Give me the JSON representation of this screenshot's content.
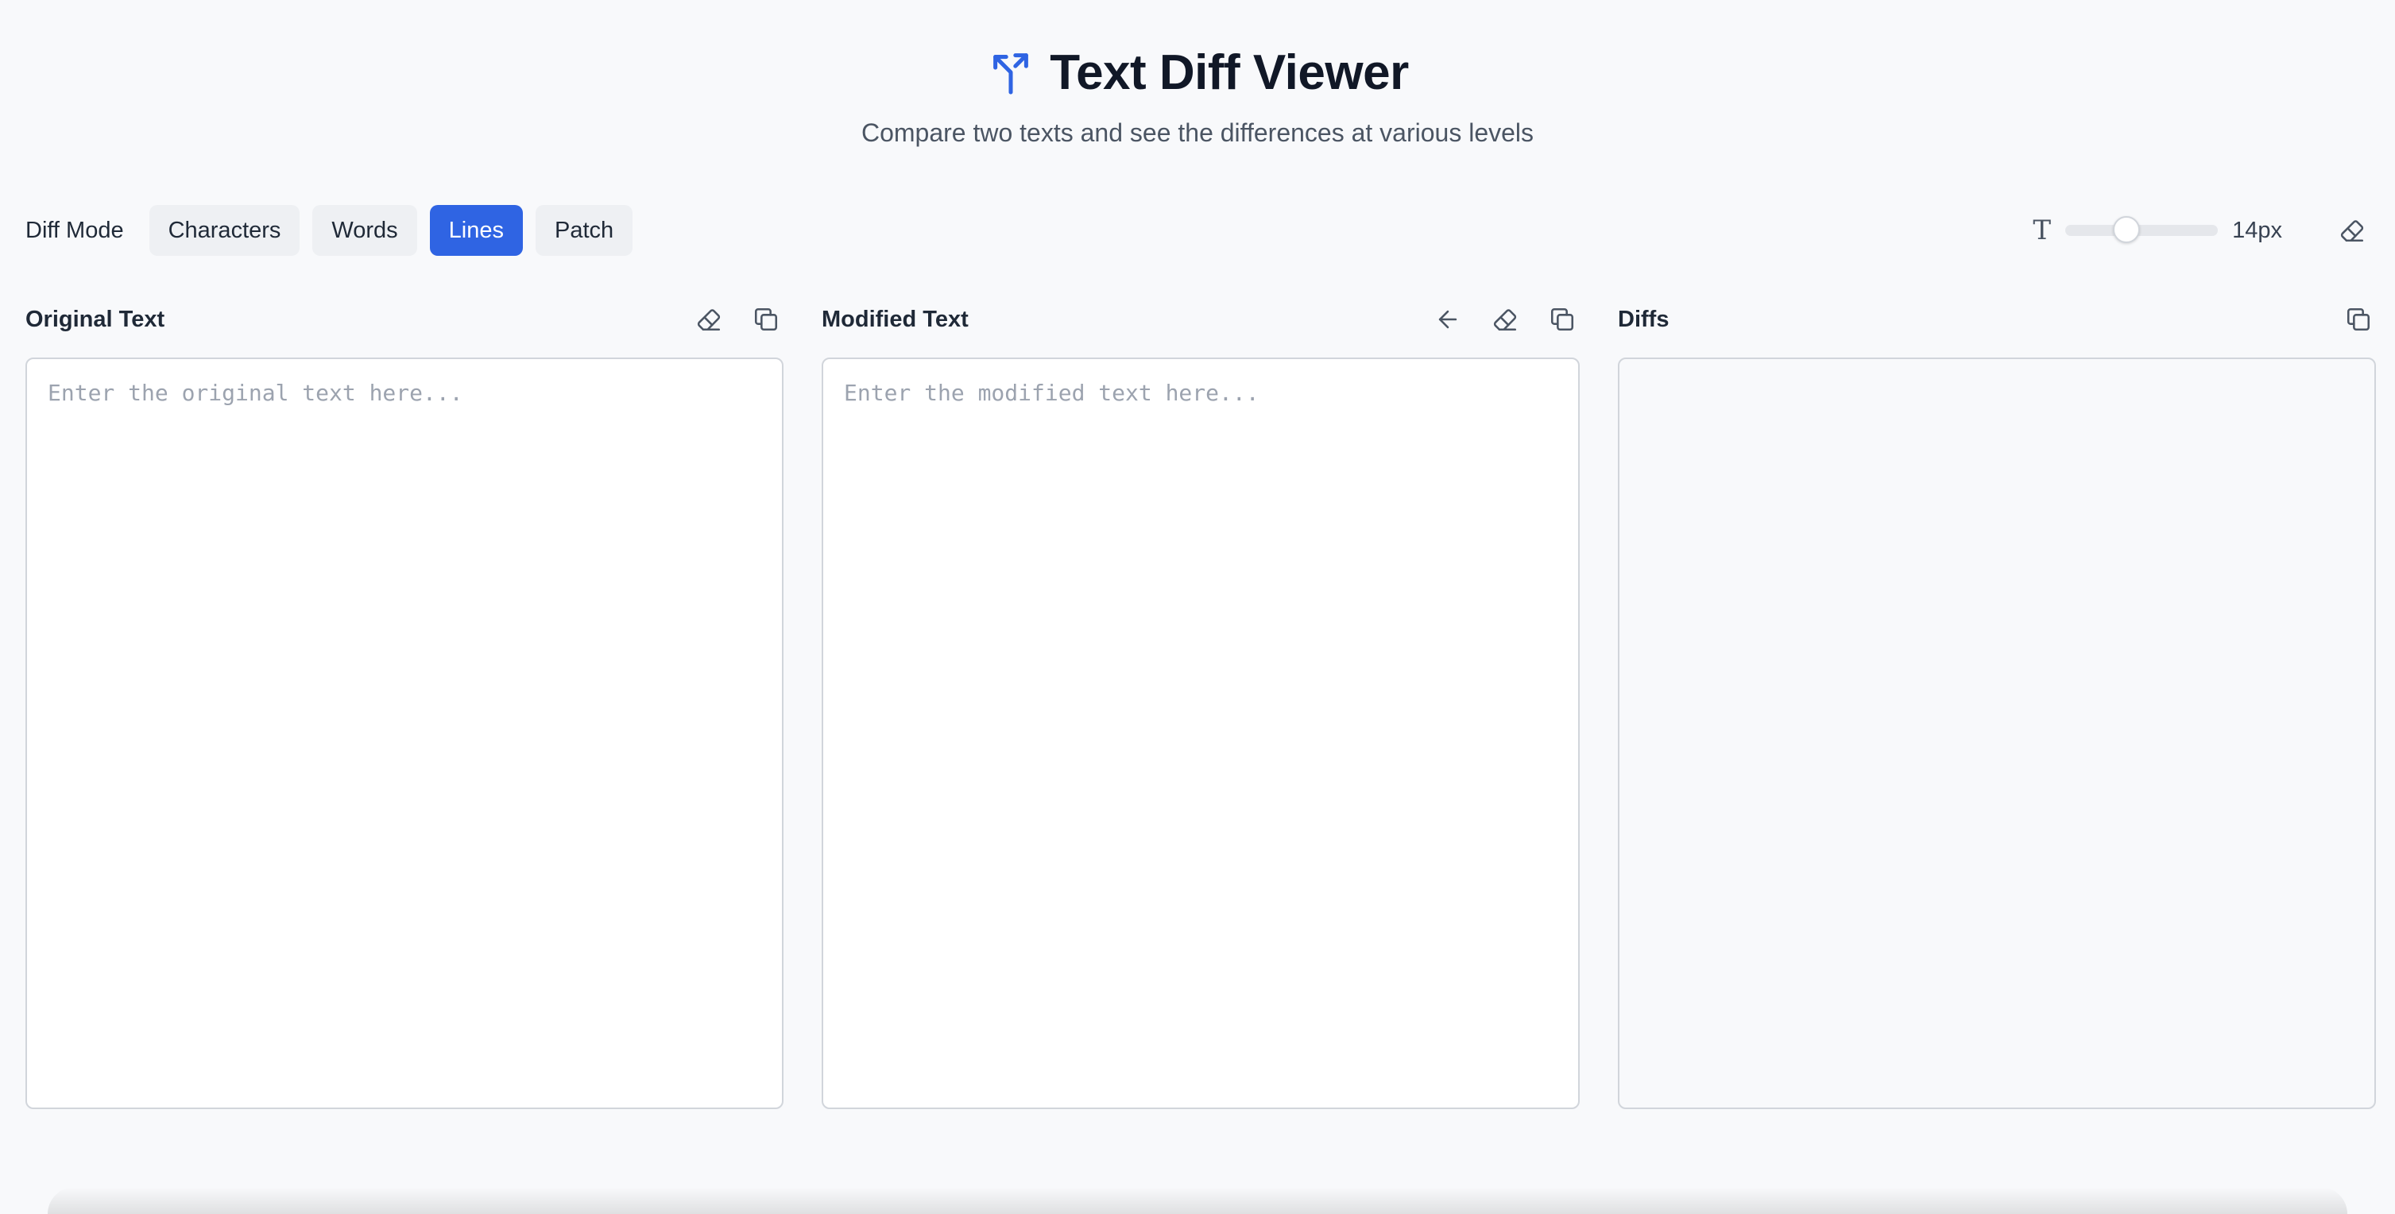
{
  "header": {
    "title": "Text Diff Viewer",
    "subtitle": "Compare two texts and see the differences at various levels",
    "icon": "branch-merge-icon"
  },
  "toolbar": {
    "mode_label": "Diff Mode",
    "modes": [
      {
        "label": "Characters",
        "active": false
      },
      {
        "label": "Words",
        "active": false
      },
      {
        "label": "Lines",
        "active": true
      },
      {
        "label": "Patch",
        "active": false
      }
    ],
    "font_size_value": "14px",
    "font_size_slider_fraction": 0.38,
    "icons": [
      "font-size-icon",
      "eraser-icon"
    ]
  },
  "panels": {
    "original": {
      "title": "Original Text",
      "placeholder": "Enter the original text here...",
      "value": "",
      "icons": [
        "eraser-icon",
        "copy-icon"
      ]
    },
    "modified": {
      "title": "Modified Text",
      "placeholder": "Enter the modified text here...",
      "value": "",
      "icons": [
        "arrow-left-icon",
        "eraser-icon",
        "copy-icon"
      ]
    },
    "diffs": {
      "title": "Diffs",
      "icons": [
        "copy-icon"
      ]
    }
  },
  "colors": {
    "accent": "#2f64e3",
    "background": "#f8f9fb",
    "button_bg": "#eef0f3",
    "border": "#d1d5db"
  }
}
